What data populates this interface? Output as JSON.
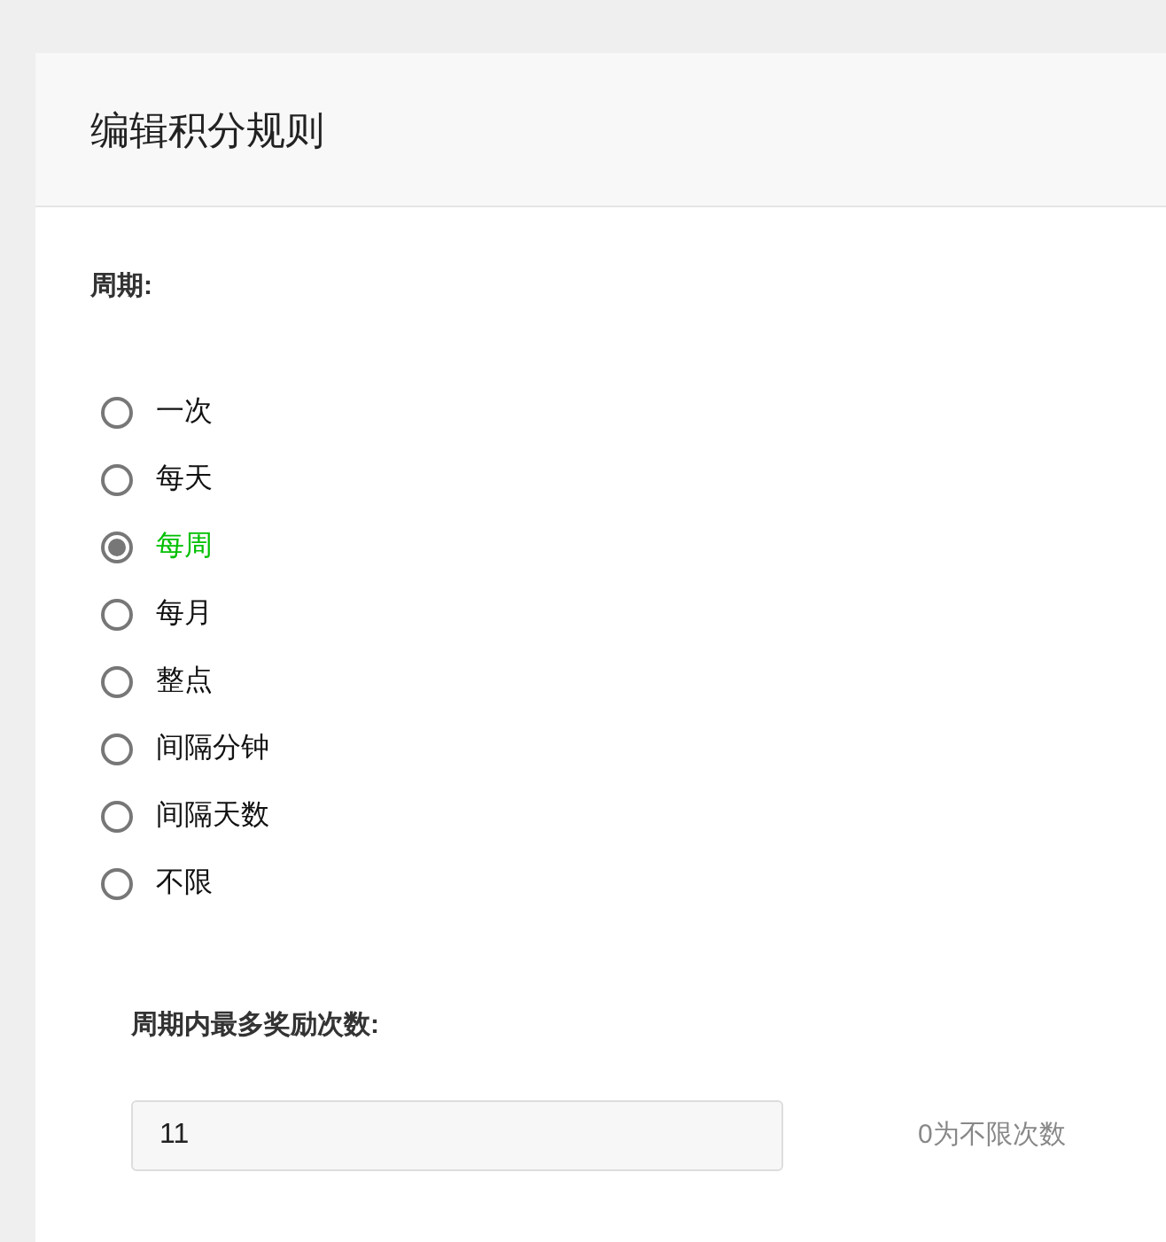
{
  "header": {
    "title": "编辑积分规则"
  },
  "period": {
    "label": "周期:",
    "options": [
      {
        "label": "一次",
        "selected": false
      },
      {
        "label": "每天",
        "selected": false
      },
      {
        "label": "每周",
        "selected": true
      },
      {
        "label": "每月",
        "selected": false
      },
      {
        "label": "整点",
        "selected": false
      },
      {
        "label": "间隔分钟",
        "selected": false
      },
      {
        "label": "间隔天数",
        "selected": false
      },
      {
        "label": "不限",
        "selected": false
      }
    ]
  },
  "max_rewards": {
    "label": "周期内最多奖励次数:",
    "value": "11",
    "hint": "0为不限次数"
  }
}
